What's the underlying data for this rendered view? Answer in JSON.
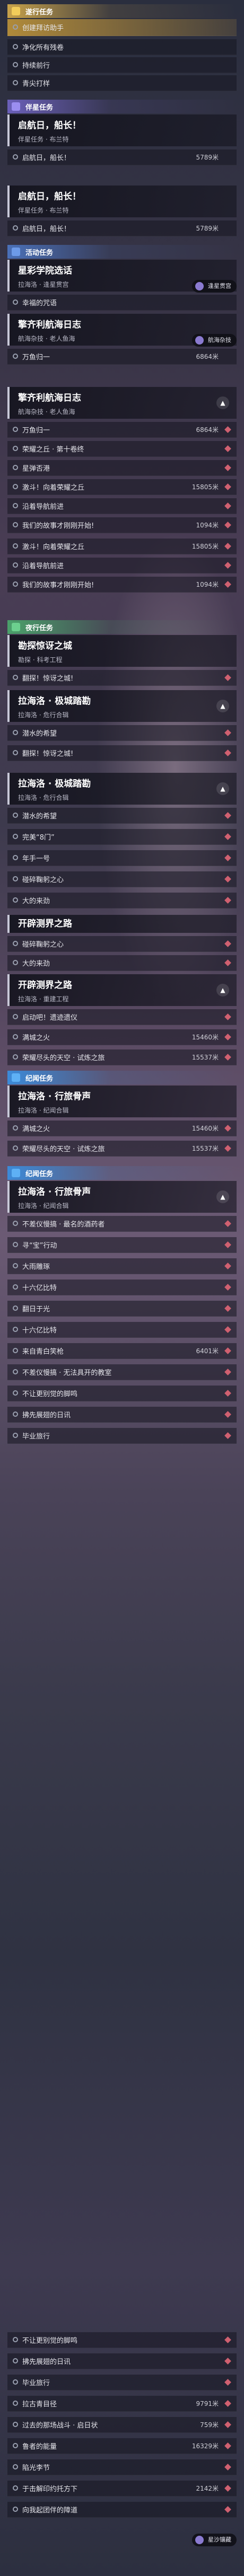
{
  "headers": {
    "trail": "遂行任务",
    "companion": "伴星任务",
    "event": "活动任务",
    "side": "夜行任务",
    "episode": "纪闻任务"
  },
  "trail_list": {
    "tutorial": "创建拜访助手",
    "s1": "净化所有残卷",
    "s2": "持续前行",
    "s3": "青尖打样"
  },
  "companion": {
    "title": "启航日，船长！",
    "sub": "伴星任务 · 布兰特",
    "step": "启航日，船长！",
    "step_dist": "5789米"
  },
  "companion2": {
    "title": "启航日，船长！",
    "sub": "伴星任务 · 布兰特",
    "step": "启航日，船长！",
    "step_dist": "5789米"
  },
  "event1": {
    "title": "星彩学院选话",
    "sub": "拉海洛 · 逢星贯宫",
    "step": "幸福的咒语",
    "pill": "逢星贯宫"
  },
  "event2": {
    "title": "擎齐利航海日志",
    "sub": "航海杂技 · 老人鱼海",
    "step": "万鱼归一",
    "step_dist": "6864米",
    "pill": "航海杂技"
  },
  "event3": {
    "title": "擎齐利航海日志",
    "sub": "航海杂技 · 老人鱼海",
    "steps": [
      {
        "t": "万鱼归一",
        "d": "6864米"
      },
      {
        "t": "荣耀之丘 · 第十卷终",
        "d": ""
      },
      {
        "t": "星弹否港",
        "d": ""
      },
      {
        "t": "激斗！向着荣耀之丘",
        "d": "15805米"
      },
      {
        "t": "沿着导航前进",
        "d": ""
      },
      {
        "t": "我们的故事才刚刚开始!",
        "d": "1094米"
      }
    ]
  },
  "event3b": {
    "steps": [
      {
        "t": "激斗！向着荣耀之丘",
        "d": "15805米"
      },
      {
        "t": "沿着导航前进",
        "d": ""
      },
      {
        "t": "我们的故事才刚刚开始!",
        "d": "1094米"
      }
    ]
  },
  "side1": {
    "title": "勘探惊讶之城",
    "sub": "勘探 · 科考工程",
    "step": "翻探！惊讶之城!"
  },
  "side2": {
    "title": "拉海洛 · 极城踏勘",
    "sub": "拉海洛 · 危行合辑",
    "steps": [
      {
        "t": "潜水的希望",
        "d": ""
      },
      {
        "t": "翻探！惊讶之城!",
        "d": ""
      }
    ]
  },
  "side3": {
    "title": "拉海洛 · 极城踏勘",
    "sub": "拉海洛 · 危行合辑",
    "steps": [
      {
        "t": "潜水的希望",
        "d": ""
      },
      {
        "t": "完美“8门”",
        "d": ""
      },
      {
        "t": "年手一号",
        "d": ""
      },
      {
        "t": "碰碎鞠躬之心",
        "d": ""
      },
      {
        "t": "大的来劲",
        "d": ""
      }
    ]
  },
  "section_open": "开辟测界之路",
  "open_steps": [
    {
      "t": "碰碎鞠躬之心",
      "d": ""
    },
    {
      "t": "大的来劲",
      "d": ""
    }
  ],
  "side4": {
    "title": "开辟测界之路",
    "sub": "拉海洛 · 重建工程",
    "steps": [
      {
        "t": "启动吧！遗迹遗仪",
        "d": ""
      },
      {
        "t": "满城之火",
        "d": "15460米"
      },
      {
        "t": "荣耀尽头的天空 · 试炼之旅",
        "d": "15537米"
      }
    ]
  },
  "ep_steps": [
    {
      "t": "满城之火",
      "d": "15460米"
    },
    {
      "t": "荣耀尽头的天空 · 试炼之旅",
      "d": "15537米"
    }
  ],
  "ep1": {
    "title": "拉海洛 · 行旅骨声",
    "sub": "拉海洛 · 纪闻合辑",
    "step": "拉海洛 · 行旅骨声"
  },
  "ep2": {
    "title": "拉海洛 · 行旅骨声",
    "sub": "拉海洛 · 纪闻合辑",
    "steps": [
      {
        "t": "不差仪慢搞 · 最名的酒药者",
        "d": ""
      },
      {
        "t": "寻“宝”行动",
        "d": ""
      },
      {
        "t": "大雨雕琢",
        "d": ""
      },
      {
        "t": "十六亿比特",
        "d": ""
      },
      {
        "t": "翻日于光",
        "d": ""
      },
      {
        "t": "十六亿比特",
        "d": ""
      },
      {
        "t": "来自青白笑枪",
        "d": "6401米"
      },
      {
        "t": "不差仪慢搞 · 无法具开的教室",
        "d": ""
      },
      {
        "t": "不让更别觉的脚鸣",
        "d": ""
      },
      {
        "t": "拂先展翅的日讯",
        "d": ""
      },
      {
        "t": "毕业旅行",
        "d": ""
      }
    ]
  },
  "ep3_steps": [
    {
      "t": "不让更别觉的脚鸣",
      "d": ""
    },
    {
      "t": "拂先展翅的日讯",
      "d": ""
    },
    {
      "t": "毕业旅行",
      "d": ""
    },
    {
      "t": "拉古青目径",
      "d": "9791米"
    },
    {
      "t": "过去的那场战斗 · 启日状",
      "d": "759米"
    },
    {
      "t": "鲁者的能量",
      "d": "16329米"
    },
    {
      "t": "陷光李节",
      "d": ""
    },
    {
      "t": "于击解印约托方下",
      "d": "2142米"
    },
    {
      "t": "向我起团伴的障道",
      "d": ""
    }
  ],
  "ep3_pill": "星沙镶藏",
  "colors": {
    "trail": "#f2cc5a",
    "companion": "#9b8ef0",
    "event": "#6d9ae8",
    "side": "#6cd08e",
    "episode": "#5eb0f5",
    "marker": "#d06070"
  }
}
